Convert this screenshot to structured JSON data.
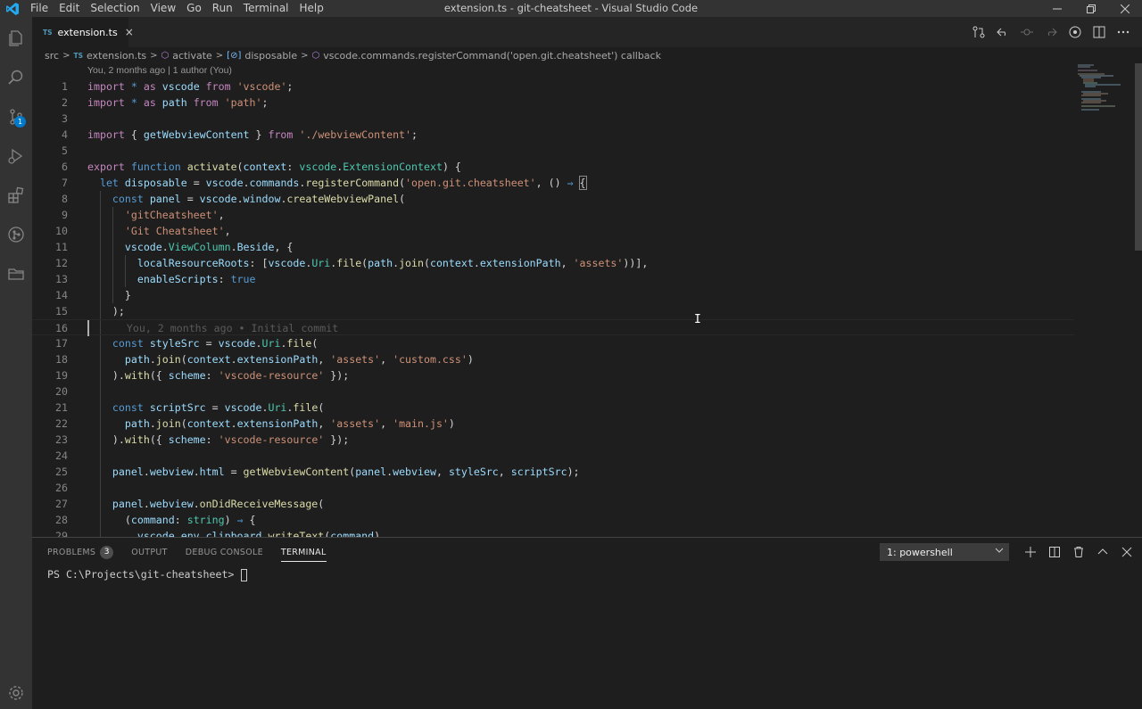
{
  "window": {
    "title": "extension.ts - git-cheatsheet - Visual Studio Code",
    "menu": [
      "File",
      "Edit",
      "Selection",
      "View",
      "Go",
      "Run",
      "Terminal",
      "Help"
    ]
  },
  "activity_bar": {
    "icons": [
      "files-icon",
      "search-icon",
      "source-control-icon",
      "run-debug-icon",
      "extensions-icon",
      "git-graph-icon",
      "folder-icon",
      "settings-gear-icon"
    ],
    "scm_badge": "1"
  },
  "tab": {
    "lang": "TS",
    "label": "extension.ts",
    "close": "×"
  },
  "breadcrumb": {
    "folder": "src",
    "file_lang": "TS",
    "file": "extension.ts",
    "fn": "activate",
    "var": "disposable",
    "call": "vscode.commands.registerCommand('open.git.cheatsheet') callback"
  },
  "codelens": "You, 2 months ago | 1 author (You)",
  "blame_inline": "You, 2 months ago • Initial commit",
  "code_lines": [
    "1",
    "2",
    "3",
    "4",
    "5",
    "6",
    "7",
    "8",
    "9",
    "10",
    "11",
    "12",
    "13",
    "14",
    "15",
    "16",
    "17",
    "18",
    "19",
    "20",
    "21",
    "22",
    "23",
    "24",
    "25",
    "26",
    "27",
    "28",
    "29"
  ],
  "panel": {
    "tabs": [
      "PROBLEMS",
      "OUTPUT",
      "DEBUG CONSOLE",
      "TERMINAL"
    ],
    "problems_count": "3",
    "terminal_select": "1: powershell",
    "prompt": "PS C:\\Projects\\git-cheatsheet> "
  }
}
